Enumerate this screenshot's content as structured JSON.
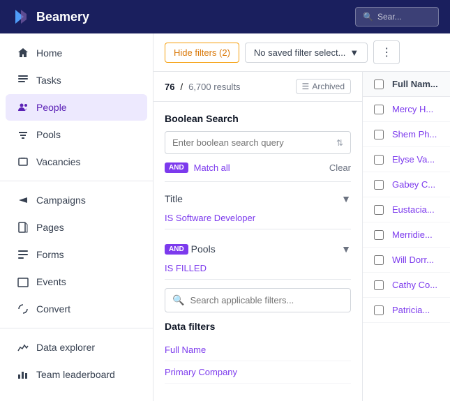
{
  "header": {
    "logo_text": "Beamery",
    "search_placeholder": "Sear..."
  },
  "sidebar": {
    "items": [
      {
        "id": "home",
        "label": "Home",
        "icon": "home"
      },
      {
        "id": "tasks",
        "label": "Tasks",
        "icon": "tasks"
      },
      {
        "id": "people",
        "label": "People",
        "icon": "people",
        "active": true
      },
      {
        "id": "pools",
        "label": "Pools",
        "icon": "pools"
      },
      {
        "id": "vacancies",
        "label": "Vacancies",
        "icon": "vacancies"
      },
      {
        "id": "campaigns",
        "label": "Campaigns",
        "icon": "campaigns"
      },
      {
        "id": "pages",
        "label": "Pages",
        "icon": "pages"
      },
      {
        "id": "forms",
        "label": "Forms",
        "icon": "forms"
      },
      {
        "id": "events",
        "label": "Events",
        "icon": "events"
      },
      {
        "id": "convert",
        "label": "Convert",
        "icon": "convert"
      },
      {
        "id": "data-explorer",
        "label": "Data explorer",
        "icon": "data-explorer"
      },
      {
        "id": "team-leaderboard",
        "label": "Team leaderboard",
        "icon": "team-leaderboard"
      }
    ]
  },
  "toolbar": {
    "hide_filters_label": "Hide filters (2)",
    "saved_filter_placeholder": "No saved filter select...",
    "more_icon": "⋮"
  },
  "results": {
    "current": "76",
    "total": "6,700",
    "results_label": "results",
    "archived_label": "Archived"
  },
  "filters": {
    "boolean_search": {
      "label": "Boolean Search",
      "placeholder": "Enter boolean search query"
    },
    "match_all": {
      "and_label": "AND",
      "text": "Match all",
      "clear": "Clear"
    },
    "title_filter": {
      "label": "Title",
      "and_label": "",
      "value": "IS Software Developer"
    },
    "pools_filter": {
      "and_label": "AND",
      "label": "Pools",
      "value": "IS FILLED"
    },
    "search_placeholder": "Search applicable filters...",
    "data_filters_label": "Data filters",
    "data_filters": [
      {
        "label": "Full Name"
      },
      {
        "label": "Primary Company"
      }
    ]
  },
  "table": {
    "col_full_name": "Full Nam...",
    "rows": [
      {
        "name": "Mercy H..."
      },
      {
        "name": "Shem Ph..."
      },
      {
        "name": "Elyse Va..."
      },
      {
        "name": "Gabey C..."
      },
      {
        "name": "Eustacia..."
      },
      {
        "name": "Merridie..."
      },
      {
        "name": "Will Dorr..."
      },
      {
        "name": "Cathy Co..."
      },
      {
        "name": "Patricia..."
      }
    ]
  }
}
